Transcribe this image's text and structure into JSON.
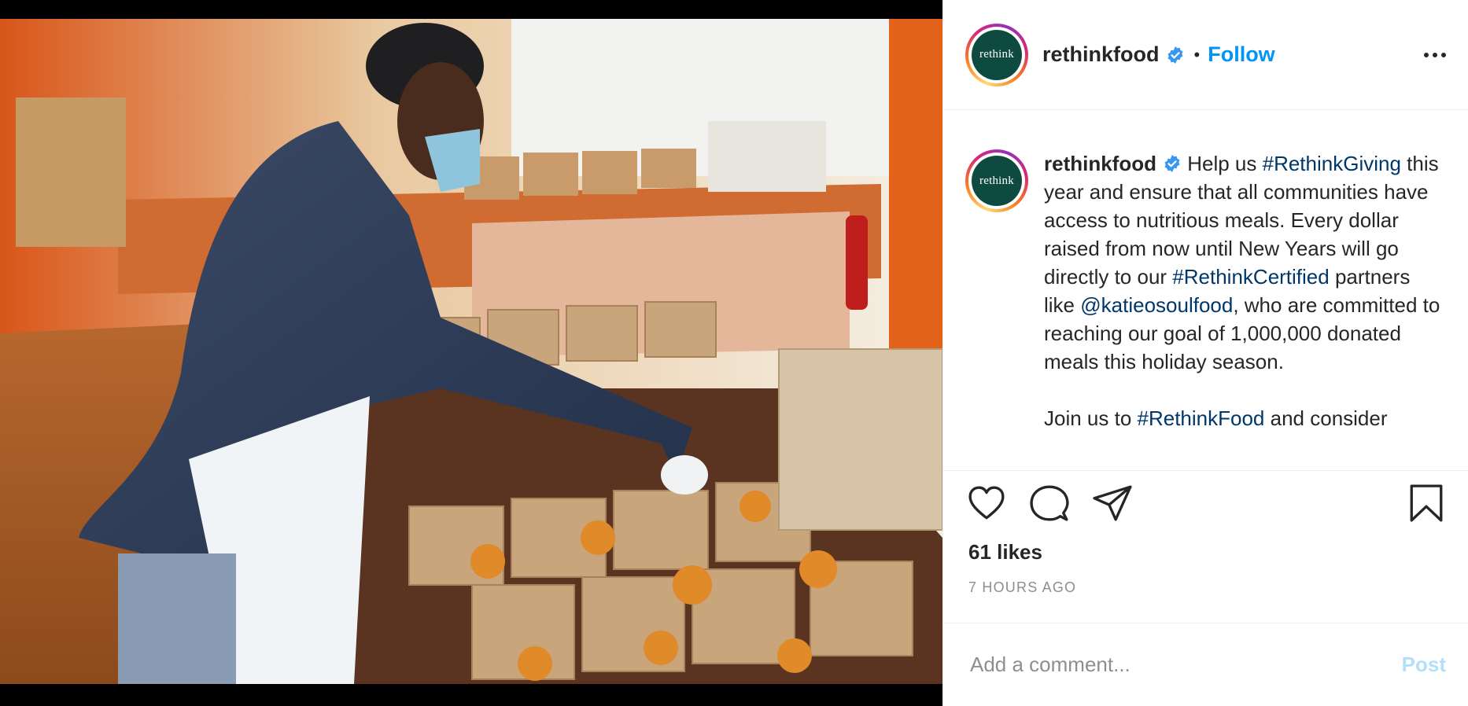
{
  "media": {
    "icon": "photo-of-volunteer-packing-meal-boxes"
  },
  "header": {
    "avatar_text": "rethink",
    "username": "rethinkfood",
    "separator": "•",
    "follow_label": "Follow",
    "verified_icon": "verified-badge-icon",
    "more_icon": "more-options-icon"
  },
  "caption": {
    "avatar_text": "rethink",
    "username": "rethinkfood",
    "t1": " Help us ",
    "tag1": "#RethinkGiving",
    "t2": " this year and ensure that all communities have access to nutritious meals. Every dollar raised from now until New Years will go directly to our ",
    "tag2": "#RethinkCertified",
    "t3": " partners like ",
    "mention": "@katieosoulfood",
    "t4": ", who are committed to reaching our goal of 1,000,000 donated meals this holiday season.",
    "t5": "Join us to ",
    "tag3": "#RethinkFood",
    "t6": " and consider"
  },
  "actions": {
    "like_icon": "heart-icon",
    "comment_icon": "comment-icon",
    "share_icon": "paper-plane-icon",
    "save_icon": "bookmark-icon"
  },
  "likes": "61 likes",
  "timestamp": "7 HOURS AGO",
  "comment": {
    "placeholder": "Add a comment...",
    "post_label": "Post"
  },
  "colors": {
    "accent": "#0095f6",
    "link": "#00376b",
    "muted": "#8e8e8e",
    "avatar_bg": "#0e4a3f"
  }
}
